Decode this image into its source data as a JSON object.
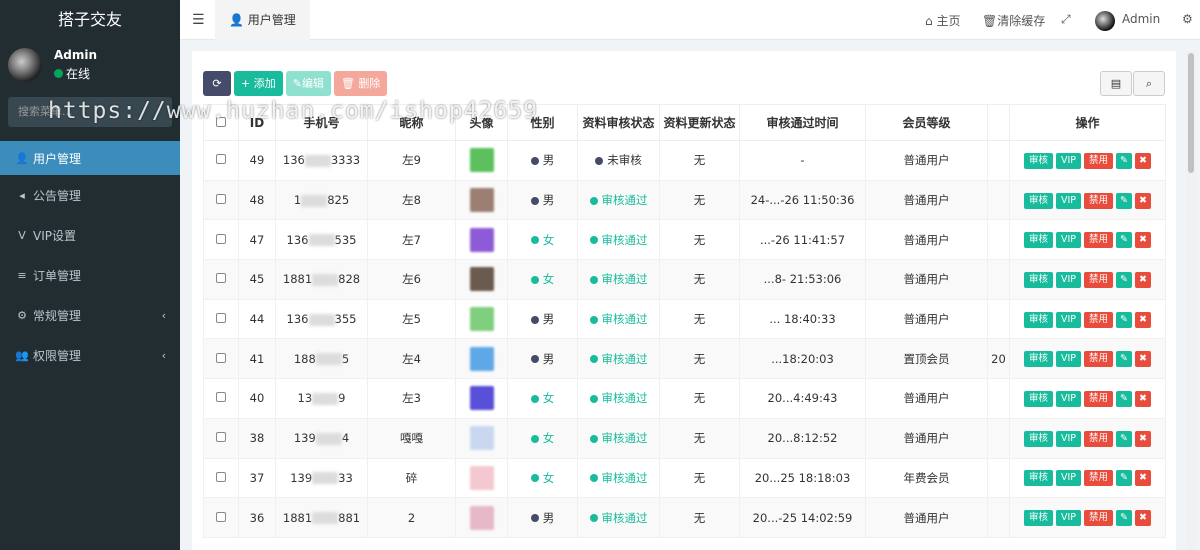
{
  "app": {
    "title": "搭子交友"
  },
  "user": {
    "name": "Admin",
    "status": "在线"
  },
  "search": {
    "placeholder": "搜索菜单..."
  },
  "menu": [
    {
      "label": "用户管理",
      "icon": "user-icon",
      "glyph": "👤",
      "active": true
    },
    {
      "label": "公告管理",
      "icon": "megaphone-icon",
      "glyph": "◂",
      "active": false
    },
    {
      "label": "VIP设置",
      "icon": "vip-icon",
      "glyph": "V",
      "active": false
    },
    {
      "label": "订单管理",
      "icon": "list-icon",
      "glyph": "≡",
      "active": false
    },
    {
      "label": "常规管理",
      "icon": "cogs-icon",
      "glyph": "⚙",
      "active": false,
      "chevron": true
    },
    {
      "label": "权限管理",
      "icon": "group-icon",
      "glyph": "👥",
      "active": false,
      "chevron": true
    }
  ],
  "topbar": {
    "tab": "用户管理",
    "home": "主页",
    "clear_cache": "清除缓存",
    "admin": "Admin"
  },
  "toolbar": {
    "add": "添加",
    "edit": "编辑",
    "delete": "删除"
  },
  "table": {
    "headers": [
      "",
      "ID",
      "手机号",
      "昵称",
      "头像",
      "性别",
      "资料审核状态",
      "资料更新状态",
      "审核通过时间",
      "会员等级",
      "",
      "操作"
    ],
    "rows": [
      {
        "id": "49",
        "phone_a": "136",
        "phone_b": "3333",
        "nick": "左9",
        "gender": "男",
        "audit": "未审核",
        "update": "无",
        "time": "-",
        "level": "普通用户",
        "extra": "",
        "thumb": "#5cc05c"
      },
      {
        "id": "48",
        "phone_a": "1",
        "phone_b": "825",
        "nick": "左8",
        "gender": "男",
        "audit": "审核通过",
        "update": "无",
        "time": "24-...-26 11:50:36",
        "level": "普通用户",
        "extra": "",
        "thumb": "#9c7f72"
      },
      {
        "id": "47",
        "phone_a": "136",
        "phone_b": "535",
        "nick": "左7",
        "gender": "女",
        "audit": "审核通过",
        "update": "无",
        "time": "...-26 11:41:57",
        "level": "普通用户",
        "extra": "",
        "thumb": "#8e5bd8"
      },
      {
        "id": "45",
        "phone_a": "1881",
        "phone_b": "828",
        "nick": "左6",
        "gender": "女",
        "audit": "审核通过",
        "update": "无",
        "time": "...8- 21:53:06",
        "level": "普通用户",
        "extra": "",
        "thumb": "#6b5a4e"
      },
      {
        "id": "44",
        "phone_a": "136",
        "phone_b": "355",
        "nick": "左5",
        "gender": "男",
        "audit": "审核通过",
        "update": "无",
        "time": "... 18:40:33",
        "level": "普通用户",
        "extra": "",
        "thumb": "#7fcf7f"
      },
      {
        "id": "41",
        "phone_a": "188",
        "phone_b": "5",
        "nick": "左4",
        "gender": "男",
        "audit": "审核通过",
        "update": "无",
        "time": "...18:20:03",
        "level": "置顶会员",
        "extra": "20",
        "thumb": "#5fa8e8"
      },
      {
        "id": "40",
        "phone_a": "13",
        "phone_b": "9",
        "nick": "左3",
        "gender": "女",
        "audit": "审核通过",
        "update": "无",
        "time": "20...4:49:43",
        "level": "普通用户",
        "extra": "",
        "thumb": "#5a4fd8"
      },
      {
        "id": "38",
        "phone_a": "139",
        "phone_b": "4",
        "nick": "嘎嘎",
        "gender": "女",
        "audit": "审核通过",
        "update": "无",
        "time": "20...8:12:52",
        "level": "普通用户",
        "extra": "",
        "thumb": "#c9d8f0"
      },
      {
        "id": "37",
        "phone_a": "139",
        "phone_b": "33",
        "nick": "碎",
        "gender": "女",
        "audit": "审核通过",
        "update": "无",
        "time": "20...25 18:18:03",
        "level": "年费会员",
        "extra": "",
        "thumb": "#f3c9cf"
      },
      {
        "id": "36",
        "phone_a": "1881",
        "phone_b": "881",
        "nick": "2",
        "gender": "男",
        "audit": "审核通过",
        "update": "无",
        "time": "20...-25 14:02:59",
        "level": "普通用户",
        "extra": "",
        "thumb": "#e7b8c8"
      }
    ]
  },
  "ops": {
    "audit": "审核",
    "vip": "VIP",
    "ban": "禁用"
  },
  "watermark": "https://www.huzhan.com/ishop42659",
  "colors": {
    "sidebar": "#222d32",
    "active": "#3c8dbc",
    "success": "#18bc9c",
    "danger": "#e74c3c",
    "male_dot": "#444c69"
  }
}
